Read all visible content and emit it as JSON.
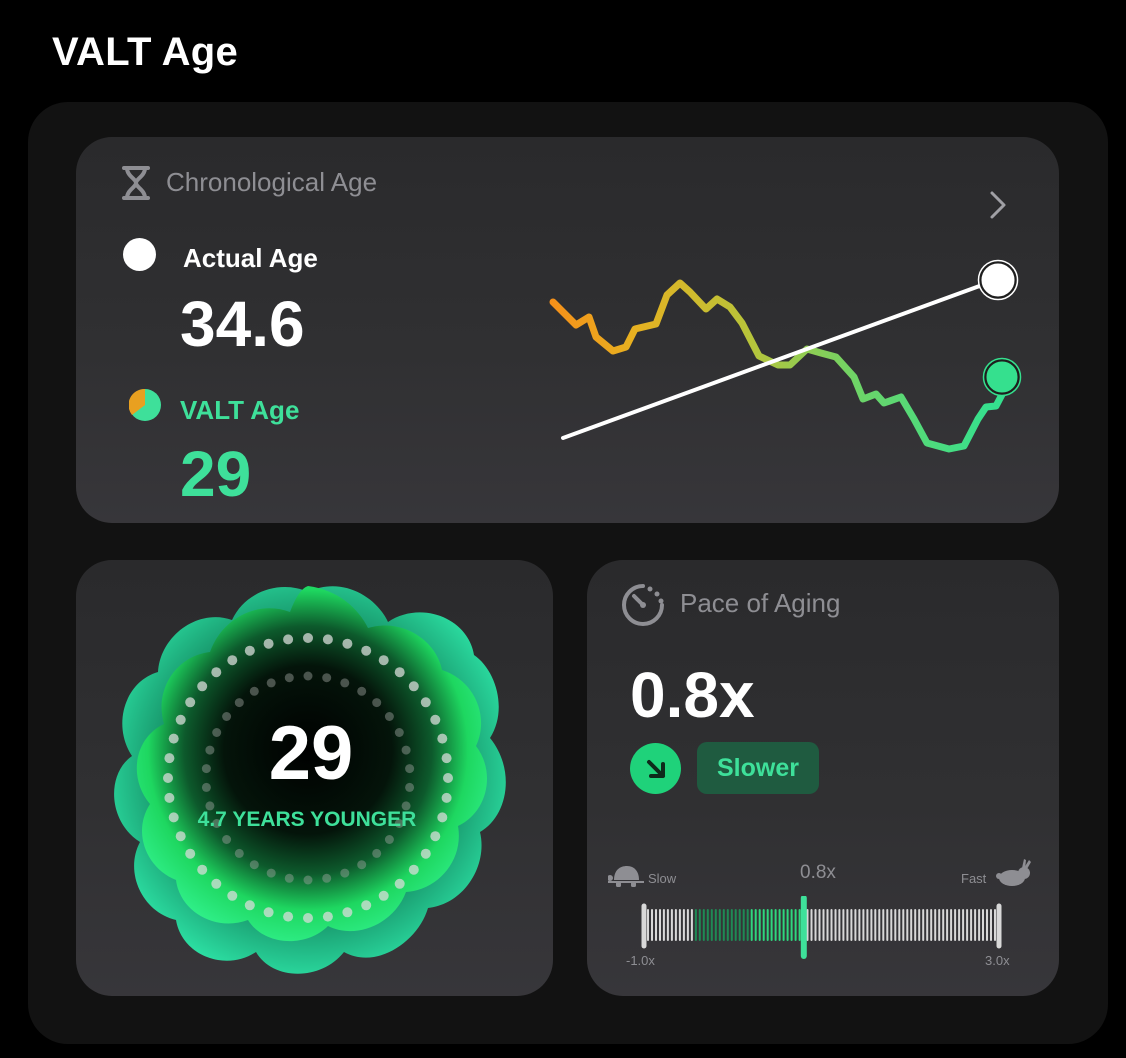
{
  "page": {
    "title": "VALT Age"
  },
  "chronological_card": {
    "title": "Chronological Age",
    "actual_label": "Actual Age",
    "actual_value": "34.6",
    "valt_label": "VALT Age",
    "valt_value": "29",
    "icons": [
      "hourglass-icon",
      "chevron-right-icon"
    ]
  },
  "valt_ring_card": {
    "value": "29",
    "caption": "4.7 YEARS YOUNGER",
    "colors": {
      "accent": "#3ee09a",
      "glow": "#1ed760"
    }
  },
  "pace_card": {
    "title": "Pace of Aging",
    "value": "0.8x",
    "status_label": "Slower",
    "scale": {
      "slow_label": "Slow",
      "fast_label": "Fast",
      "marker_label": "0.8x",
      "min_label": "-1.0x",
      "max_label": "3.0x",
      "min": -1.0,
      "max": 3.0,
      "value": 0.8
    },
    "icons": [
      "speedometer-icon",
      "arrow-down-right-icon",
      "turtle-icon",
      "rabbit-icon"
    ]
  },
  "colors": {
    "background": "#000000",
    "panel": "#121212",
    "accent_green": "#3ee09a",
    "orange": "#f39c12"
  }
}
